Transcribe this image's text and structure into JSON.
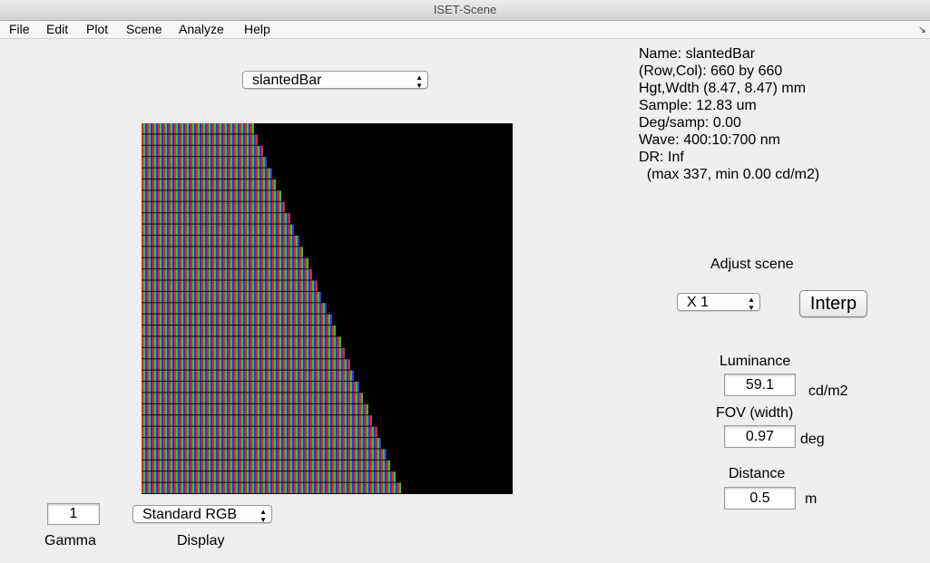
{
  "window": {
    "title": "ISET-Scene"
  },
  "menu": {
    "items": [
      "File",
      "Edit",
      "Plot",
      "Scene",
      "Analyze",
      "Help"
    ],
    "resize_glyph": "↘"
  },
  "scene_select": {
    "value": "slantedBar"
  },
  "info": {
    "lines": [
      "Name: slantedBar",
      "(Row,Col): 660 by 660",
      "Hgt,Wdth (8.47, 8.47) mm",
      "Sample: 12.83 um",
      "Deg/samp: 0.00",
      "Wave: 400:10:700 nm",
      "DR: Inf",
      "  (max 337, min 0.00 cd/m2)"
    ]
  },
  "adjust": {
    "heading": "Adjust scene",
    "scale_value": "X 1",
    "interp_label": "Interp"
  },
  "luminance": {
    "label": "Luminance",
    "value": "59.1",
    "unit": "cd/m2"
  },
  "fov": {
    "label": "FOV (width)",
    "value": "0.97",
    "unit": "deg"
  },
  "distance": {
    "label": "Distance",
    "value": "0.5",
    "unit": "m"
  },
  "gamma": {
    "label": "Gamma",
    "value": "1"
  },
  "display": {
    "label": "Display",
    "value": "Standard RGB"
  },
  "image": {
    "background": "#000000",
    "subpixel_colors": [
      "#ff2020",
      "#20d020",
      "#3030ff"
    ],
    "row_line_color": "#000000"
  }
}
